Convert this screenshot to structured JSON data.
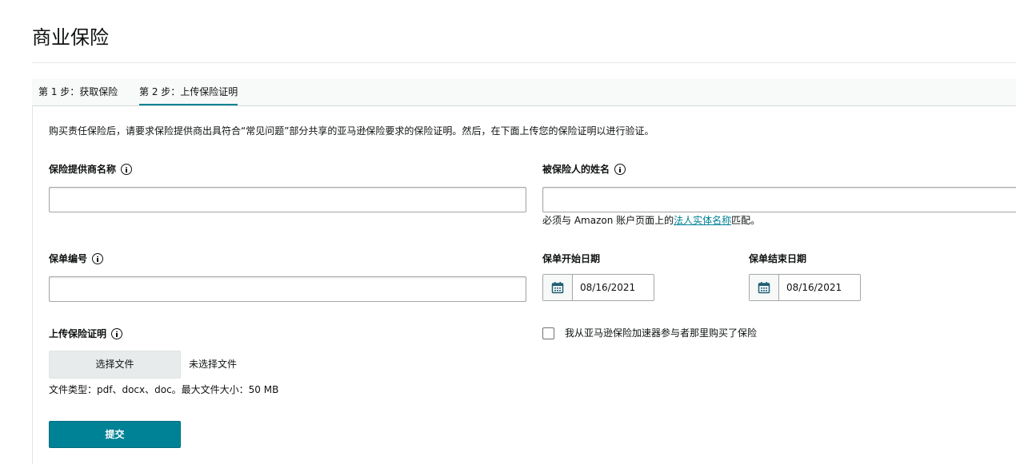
{
  "page": {
    "title": "商业保险"
  },
  "tabs": [
    {
      "label": "第 1 步：获取保险",
      "active": false
    },
    {
      "label": "第 2 步：上传保险证明",
      "active": true
    }
  ],
  "intro": "购买责任保险后，请要求保险提供商出具符合“常见问题”部分共享的亚马逊保险要求的保险证明。然后，在下面上传您的保险证明以进行验证。",
  "form": {
    "provider_name": {
      "label": "保险提供商名称",
      "value": ""
    },
    "insured_name": {
      "label": "被保险人的姓名",
      "value": "",
      "helper_prefix": "必须与 Amazon 账户页面上的",
      "helper_link": "法人实体名称",
      "helper_suffix": "匹配。"
    },
    "policy_number": {
      "label": "保单编号",
      "value": ""
    },
    "start_date": {
      "label": "保单开始日期",
      "value": "08/16/2021"
    },
    "end_date": {
      "label": "保单结束日期",
      "value": "08/16/2021"
    },
    "upload": {
      "label": "上传保险证明",
      "button_label": "选择文件",
      "no_file_text": "未选择文件",
      "file_types_text": "文件类型：pdf、docx、doc。最大文件大小：50 MB"
    },
    "accelerator_checkbox": {
      "label": "我从亚马逊保险加速器参与者那里购买了保险",
      "checked": false
    },
    "submit_label": "提交"
  },
  "colors": {
    "accent": "#008296",
    "link": "#008296",
    "text": "#0f1111"
  },
  "icons": {
    "info": "info-circle-icon",
    "calendar": "calendar-icon"
  }
}
